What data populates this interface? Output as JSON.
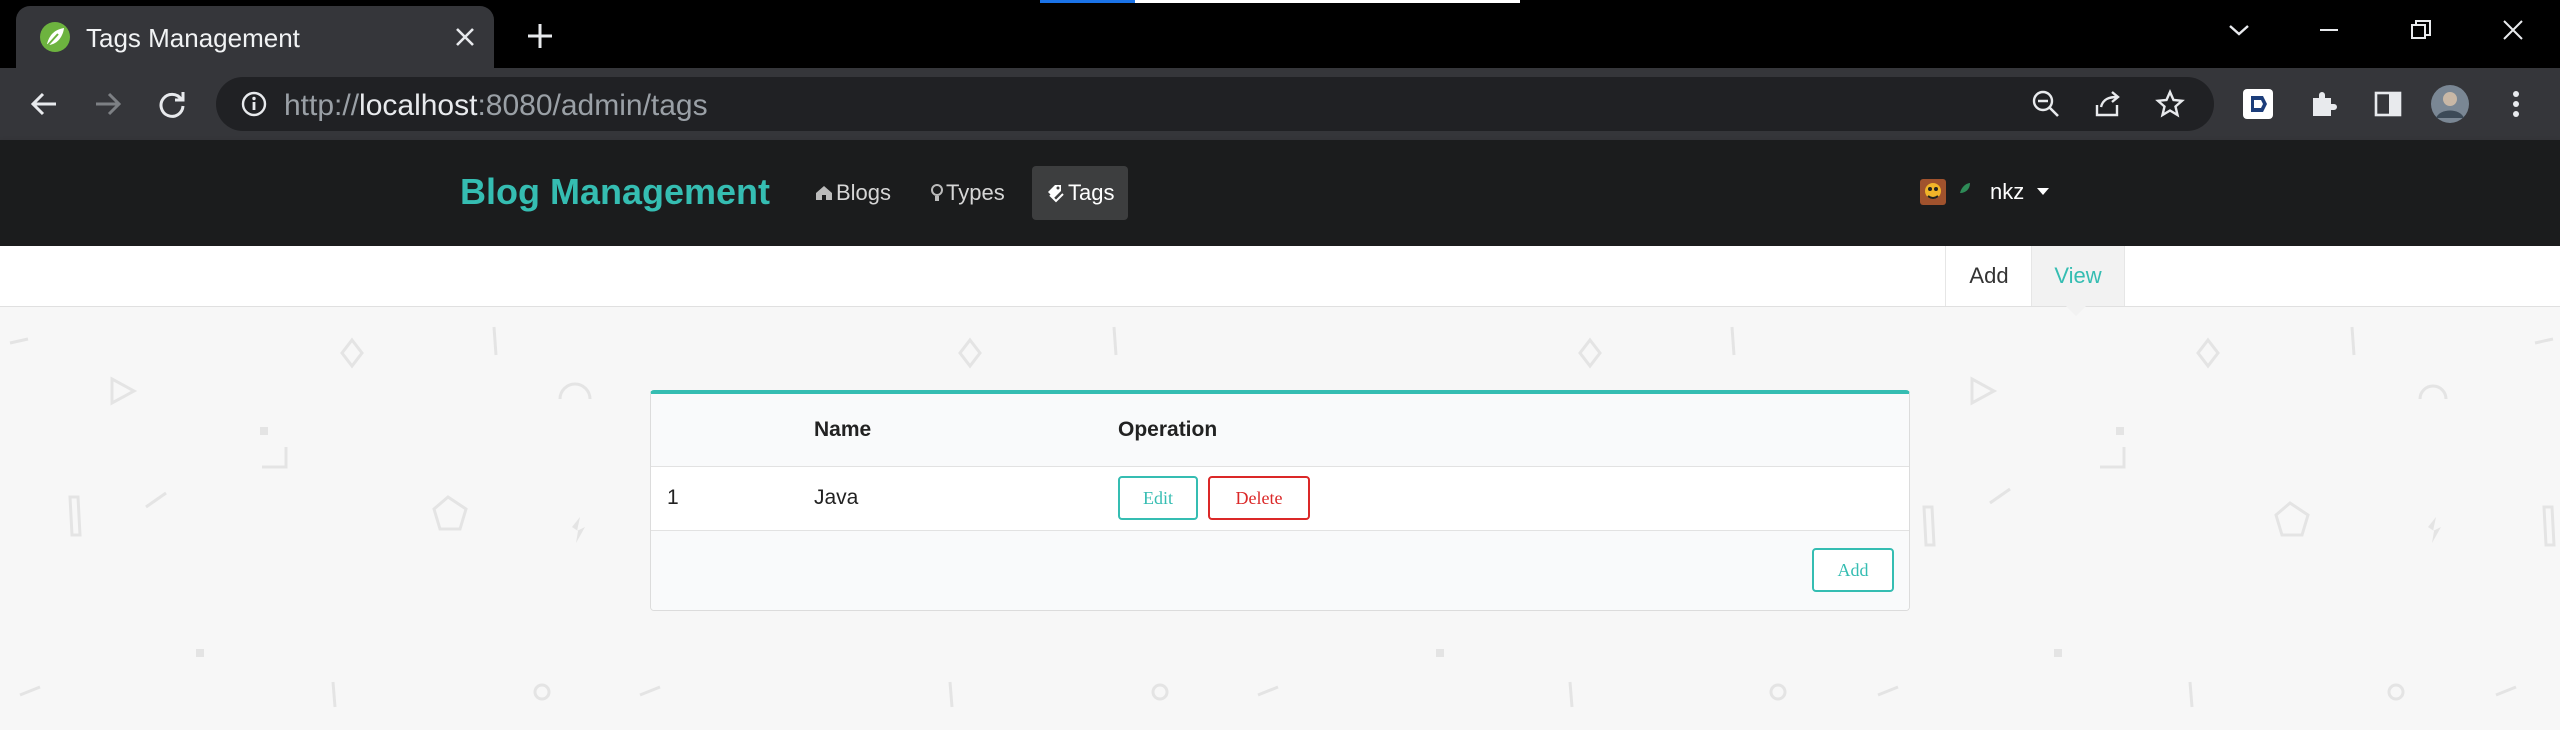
{
  "browser": {
    "tab_title": "Tags Management",
    "url_scheme": "http://",
    "url_host": "localhost",
    "url_rest": ":8080/admin/tags",
    "icons": [
      "leaf-favicon-icon",
      "close-icon",
      "plus-icon",
      "chevron-down-icon",
      "minimize-icon",
      "restore-icon",
      "close-window-icon",
      "back-arrow-icon",
      "forward-arrow-icon",
      "reload-icon",
      "info-icon",
      "zoom-out-icon",
      "share-icon",
      "star-icon",
      "extension-puzzle-icon",
      "side-panel-icon",
      "profile-avatar-icon",
      "kebab-menu-icon"
    ]
  },
  "navbar": {
    "brand": "Blog Management",
    "items": [
      {
        "label": "Blogs",
        "icon": "home-icon"
      },
      {
        "label": "Types",
        "icon": "lightbulb-icon"
      },
      {
        "label": "Tags",
        "icon": "tags-icon",
        "active": true
      }
    ],
    "username": "nkz"
  },
  "subnav": {
    "add_label": "Add",
    "view_label": "View"
  },
  "table": {
    "headers": [
      "",
      "Name",
      "Operation"
    ],
    "rows": [
      {
        "index": "1",
        "name": "Java",
        "edit_label": "Edit",
        "delete_label": "Delete"
      }
    ],
    "add_button_label": "Add"
  },
  "colors": {
    "accent": "#35bdb2",
    "danger": "#db2828",
    "navbar_bg": "#1b1c1d"
  }
}
